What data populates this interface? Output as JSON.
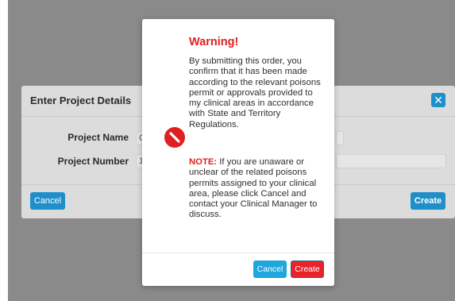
{
  "underlying_dialog": {
    "title": "Enter Project Details",
    "close_icon": "close-icon",
    "fields": [
      {
        "label": "Project Name",
        "value": "C"
      },
      {
        "label": "Project Number",
        "value": "1"
      }
    ],
    "cancel_label": "Cancel",
    "create_label": "Create"
  },
  "warning_modal": {
    "icon": "ban-icon",
    "title": "Warning!",
    "message": "By submitting this order, you confirm that it has been made according to the relevant poisons permit or approvals provided to my clinical areas in accordance with State and Territory Regulations.",
    "note_label": "NOTE:",
    "note_text": "If you are unaware or unclear of the related poisons permits assigned to your clinical area, please click Cancel and contact your Clinical Manager to discuss.",
    "cancel_label": "Cancel",
    "create_label": "Create"
  },
  "colors": {
    "accent_blue": "#1f8fc9",
    "danger_red": "#e8232a",
    "overlay_gray": "#8a8a8a"
  }
}
